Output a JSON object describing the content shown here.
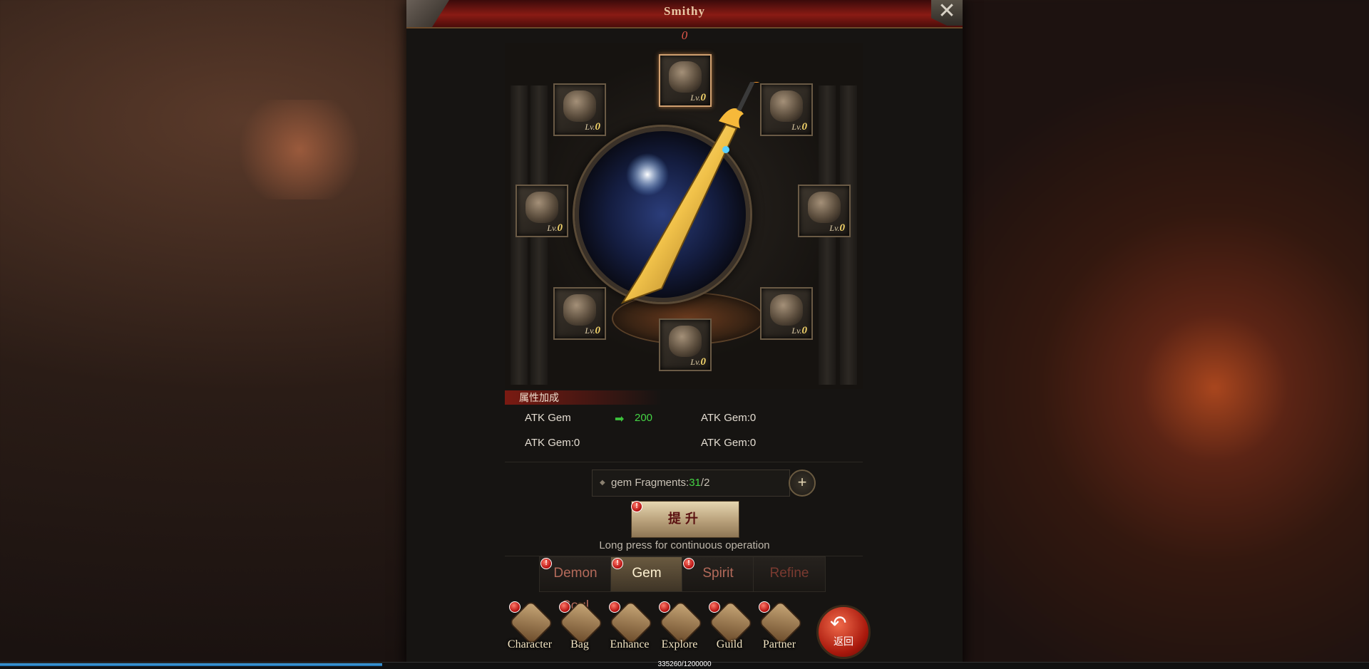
{
  "window": {
    "title": "Smithy",
    "power_value": "0",
    "close_label": "✕"
  },
  "slots": [
    {
      "name": "top",
      "lv_prefix": "Lv.",
      "level": "0"
    },
    {
      "name": "upper-left",
      "lv_prefix": "Lv.",
      "level": "0"
    },
    {
      "name": "upper-right",
      "lv_prefix": "Lv.",
      "level": "0"
    },
    {
      "name": "mid-left",
      "lv_prefix": "Lv.",
      "level": "0"
    },
    {
      "name": "mid-right",
      "lv_prefix": "Lv.",
      "level": "0"
    },
    {
      "name": "lower-left",
      "lv_prefix": "Lv.",
      "level": "0"
    },
    {
      "name": "lower-right",
      "lv_prefix": "Lv.",
      "level": "0"
    },
    {
      "name": "bottom",
      "lv_prefix": "Lv.",
      "level": "0"
    }
  ],
  "attributes": {
    "header": "属性加成",
    "rows": [
      {
        "label": "ATK Gem",
        "arrow": "➡",
        "value": "200"
      },
      {
        "label": "ATK Gem:0"
      },
      {
        "label": "ATK Gem:0"
      },
      {
        "label": "ATK Gem:0"
      }
    ]
  },
  "fragments": {
    "diamond": "◆",
    "label": "gem Fragments:",
    "current": "31",
    "separator": "/",
    "required": "2",
    "plus_label": "+"
  },
  "upgrade": {
    "label": "提升",
    "badge": "!"
  },
  "hint": "Long press for continuous operation",
  "tabs": [
    {
      "label": "Demon Soul",
      "badge": "!"
    },
    {
      "label": "Gem",
      "badge": "!"
    },
    {
      "label": "Spirit",
      "badge": "!"
    },
    {
      "label": "Refine",
      "badge": ""
    }
  ],
  "nav": [
    {
      "label": "Character"
    },
    {
      "label": "Bag"
    },
    {
      "label": "Enhance"
    },
    {
      "label": "Explore"
    },
    {
      "label": "Guild"
    },
    {
      "label": "Partner"
    }
  ],
  "back_button": {
    "label": "返回",
    "arrow": "↶"
  },
  "experience": {
    "text": "335260/1200000",
    "current": 335260,
    "max": 1200000
  },
  "colors": {
    "accent_red": "#8a1b14",
    "value_green": "#45d445",
    "badge_red": "#b40e0e",
    "exp_blue": "#4aa8e8"
  }
}
